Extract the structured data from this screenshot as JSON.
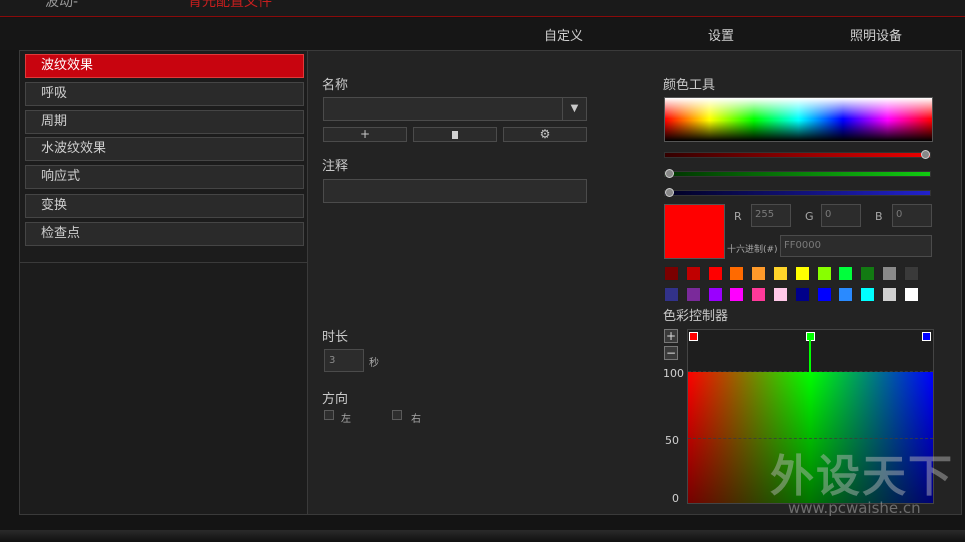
{
  "top_tabs": {
    "left_cut": "波动-",
    "right_cut": "青光配置文件"
  },
  "subnav": {
    "custom": "自定义",
    "settings": "设置",
    "lighting": "照明设备"
  },
  "effects": [
    {
      "label": "波纹效果",
      "active": true
    },
    {
      "label": "呼吸",
      "active": false
    },
    {
      "label": "周期",
      "active": false
    },
    {
      "label": "水波纹效果",
      "active": false
    },
    {
      "label": "响应式",
      "active": false
    },
    {
      "label": "变换",
      "active": false
    },
    {
      "label": "检查点",
      "active": false
    }
  ],
  "name_section": {
    "label": "名称",
    "value": "",
    "add_icon": "plus-icon",
    "delete_icon": "trash-icon",
    "settings_icon": "gear-icon"
  },
  "note_section": {
    "label": "注释",
    "value": ""
  },
  "duration": {
    "label": "时长",
    "value": "3",
    "unit": "秒"
  },
  "direction": {
    "label": "方向",
    "left": "左",
    "right": "右"
  },
  "color_tool": {
    "label": "颜色工具",
    "r_label": "R",
    "g_label": "G",
    "b_label": "B",
    "r": "255",
    "g": "0",
    "b": "0",
    "hex_label": "十六进制(#)",
    "hex": "FF0000",
    "current_color": "#ff0000",
    "red_level": 1.0,
    "green_level": 0.0,
    "blue_level": 0.0
  },
  "swatches": [
    [
      "#7a0000",
      "#c00000",
      "#ff0000",
      "#ff6a00",
      "#ff9a2a",
      "#ffd42a",
      "#ffff00",
      "#88ff00",
      "#00ff3c",
      "#127a12",
      "#8a8a8a",
      "#3a3a3a"
    ],
    [
      "#32328a",
      "#7a2a9a",
      "#9a00ff",
      "#ff00ff",
      "#ff3a9a",
      "#ffc8e8",
      "#00008a",
      "#0000ff",
      "#2a8aff",
      "#00ffff",
      "#d0d0d0",
      "#ffffff"
    ]
  ],
  "controller": {
    "label": "色彩控制器",
    "add": "+",
    "remove": "−",
    "y_labels": [
      "100",
      "50",
      "0"
    ],
    "stops": [
      "#ff0000",
      "#00ff00",
      "#0000ff"
    ]
  },
  "watermark": {
    "brand": "外设天下",
    "url": "www.pcwaishe.cn"
  }
}
